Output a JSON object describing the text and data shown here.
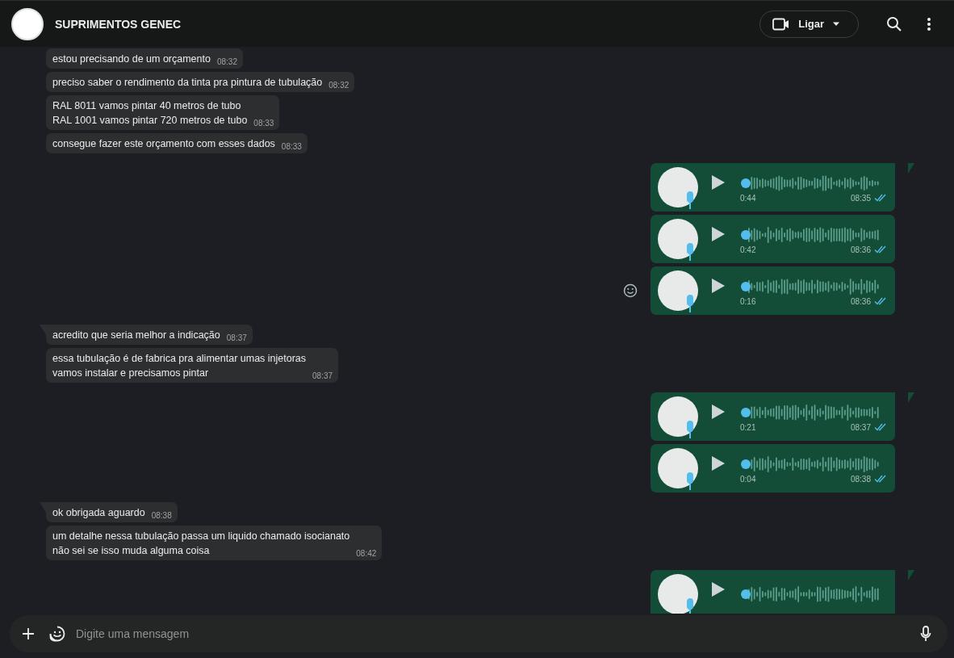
{
  "header": {
    "title": "SUPRIMENTOS GENEC",
    "call_button": "Ligar"
  },
  "messages": [
    {
      "kind": "text",
      "tail": false,
      "lines": [
        "estou precisando de um orçamento"
      ],
      "time": "08:32"
    },
    {
      "kind": "text",
      "tail": false,
      "lines": [
        "preciso saber o rendimento da tinta pra pintura de tubulação"
      ],
      "time": "08:32"
    },
    {
      "kind": "text",
      "tail": false,
      "lines": [
        "RAL 8011 vamos pintar 40 metros de tubo",
        "RAL 1001 vamos pintar 720 metros de tubo"
      ],
      "time": "08:33"
    },
    {
      "kind": "text",
      "tail": false,
      "lines": [
        "consegue fazer este orçamento com esses dados"
      ],
      "time": "08:33"
    },
    {
      "kind": "voice",
      "tail": true,
      "duration": "0:44",
      "time": "08:35",
      "read": true,
      "reaction_button": false
    },
    {
      "kind": "voice",
      "tail": false,
      "duration": "0:42",
      "time": "08:36",
      "read": true,
      "reaction_button": false
    },
    {
      "kind": "voice",
      "tail": false,
      "duration": "0:16",
      "time": "08:36",
      "read": true,
      "reaction_button": true
    },
    {
      "kind": "text",
      "tail": true,
      "lines": [
        "acredito que seria melhor a indicação"
      ],
      "time": "08:37"
    },
    {
      "kind": "text",
      "tail": false,
      "lines": [
        "essa tubulação é de fabrica pra alimentar umas injetoras",
        "vamos instalar e precisamos pintar"
      ],
      "time": "08:37"
    },
    {
      "kind": "voice",
      "tail": true,
      "duration": "0:21",
      "time": "08:37",
      "read": true,
      "reaction_button": false
    },
    {
      "kind": "voice",
      "tail": false,
      "duration": "0:04",
      "time": "08:38",
      "read": true,
      "reaction_button": false
    },
    {
      "kind": "text",
      "tail": true,
      "lines": [
        "ok obrigada aguardo"
      ],
      "time": "08:38"
    },
    {
      "kind": "text",
      "tail": false,
      "lines": [
        "um detalhe nessa tubulação passa um liquido chamado isocianato",
        "não sei se isso muda alguma coisa"
      ],
      "time": "08:42"
    },
    {
      "kind": "voice",
      "tail": true
    }
  ],
  "composer": {
    "placeholder": "Digite uma mensagem"
  }
}
